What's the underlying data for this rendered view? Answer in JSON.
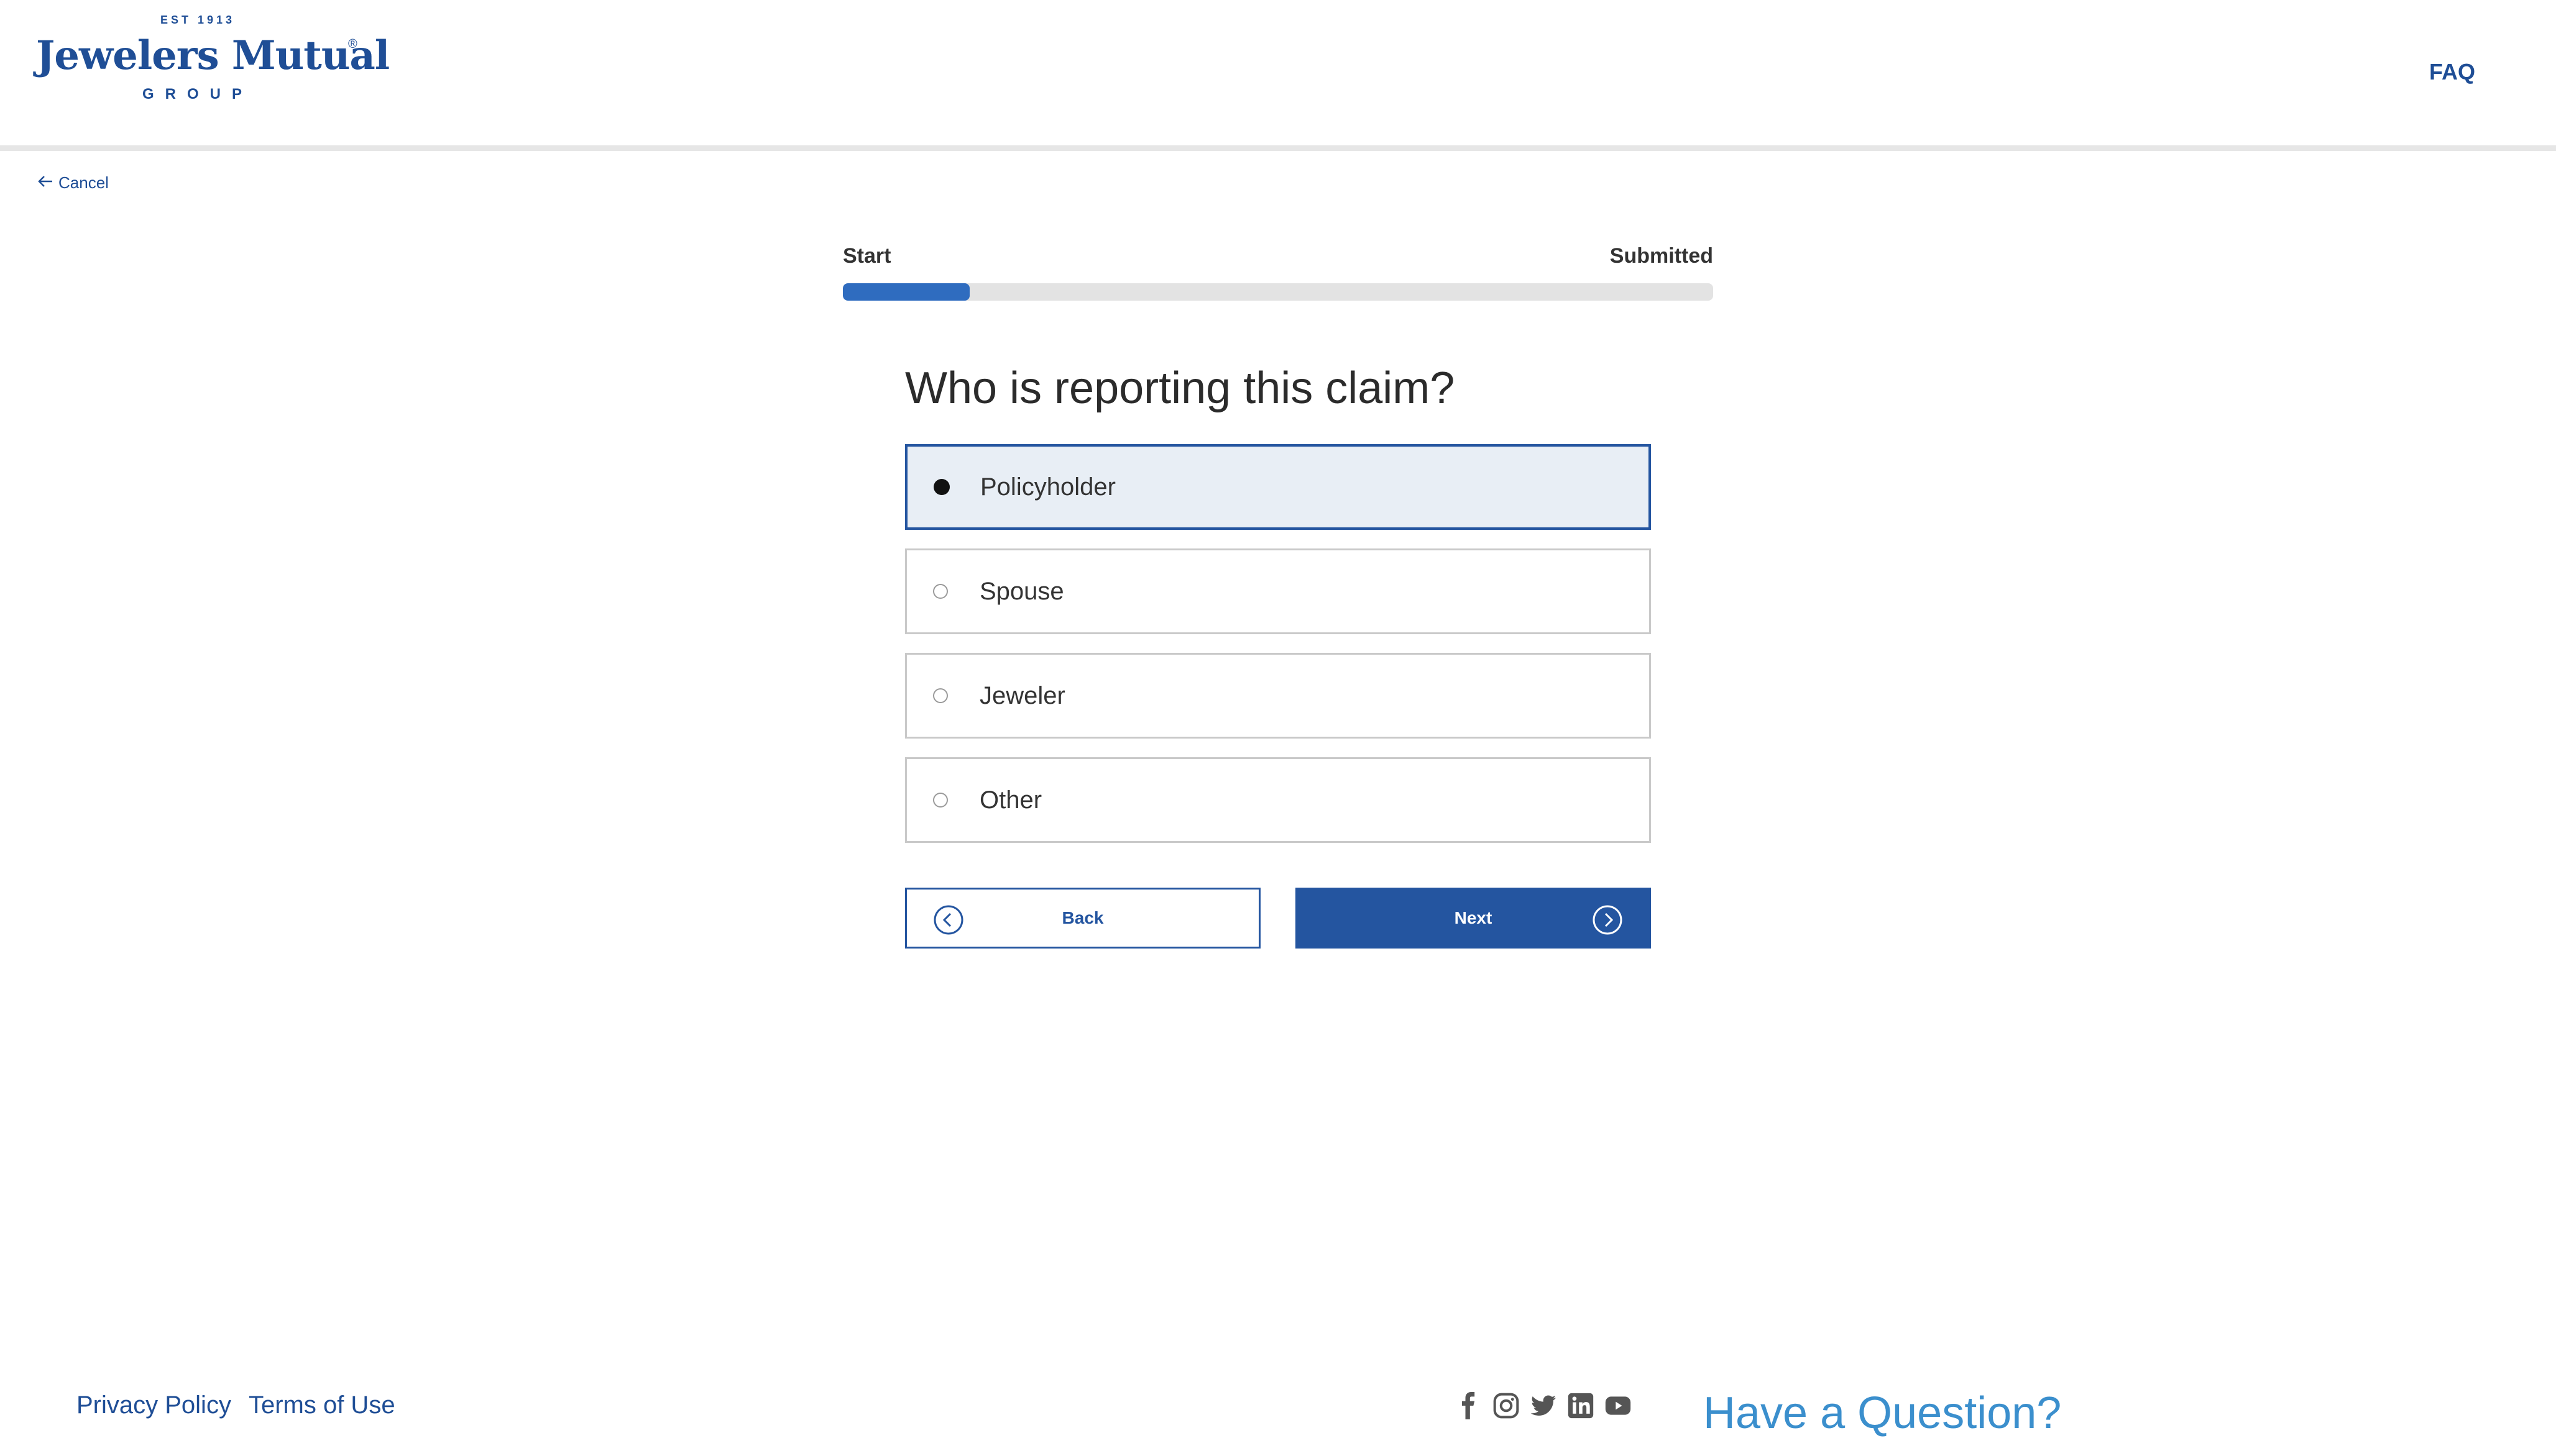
{
  "header": {
    "logo": {
      "est": "EST 1913",
      "name": "Jewelers Mutual",
      "registered": "®",
      "group": "GROUP"
    },
    "faq_label": "FAQ"
  },
  "nav": {
    "cancel_label": "Cancel"
  },
  "progress": {
    "start_label": "Start",
    "end_label": "Submitted",
    "fraction": 0.146
  },
  "form": {
    "question": "Who is reporting this claim?",
    "options": [
      {
        "label": "Policyholder",
        "selected": true
      },
      {
        "label": "Spouse",
        "selected": false
      },
      {
        "label": "Jeweler",
        "selected": false
      },
      {
        "label": "Other",
        "selected": false
      }
    ],
    "back_label": "Back",
    "next_label": "Next"
  },
  "footer": {
    "privacy_label": "Privacy Policy",
    "terms_label": "Terms of Use",
    "socials": [
      "facebook-icon",
      "instagram-icon",
      "twitter-icon",
      "linkedin-icon",
      "youtube-icon"
    ],
    "question_cta": "Have a Question?"
  },
  "colors": {
    "brand": "#1f4e96",
    "button": "#2455a0",
    "progress": "#2f6cbf",
    "selected_bg": "#e8eef5",
    "cta": "#3b8fcd"
  }
}
